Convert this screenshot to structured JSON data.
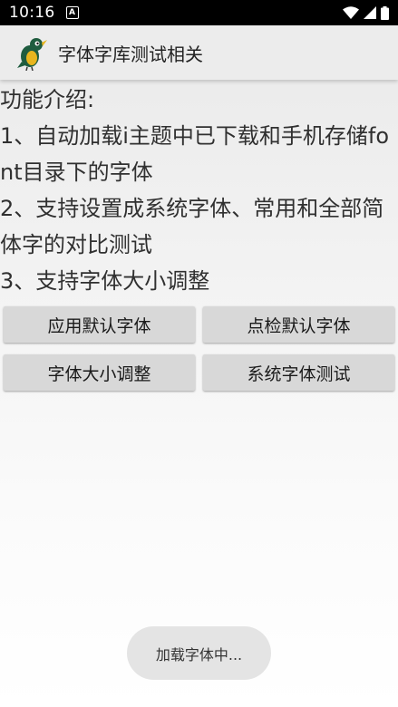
{
  "status_bar": {
    "time": "10:16",
    "notification_glyph": "A",
    "icons": [
      "wifi-icon",
      "signal-icon",
      "battery-icon"
    ]
  },
  "app_bar": {
    "title": "字体字库测试相关",
    "logo": "bird-app-logo"
  },
  "intro": {
    "heading": "功能介绍:",
    "items": [
      " 1、自动加载i主题中已下载和手机存储font目录下的字体",
      " 2、支持设置成系统字体、常用和全部简体字的对比测试",
      " 3、支持字体大小调整"
    ]
  },
  "buttons": {
    "apply_default": "应用默认字体",
    "check_default": "点检默认字体",
    "font_size": "字体大小调整",
    "system_font_test": "系统字体测试"
  },
  "toast": {
    "message": "加载字体中..."
  },
  "colors": {
    "status_bar": "#000000",
    "app_bar": "#ececec",
    "button": "#d8d8d8",
    "toast": "#e4e4e4"
  }
}
